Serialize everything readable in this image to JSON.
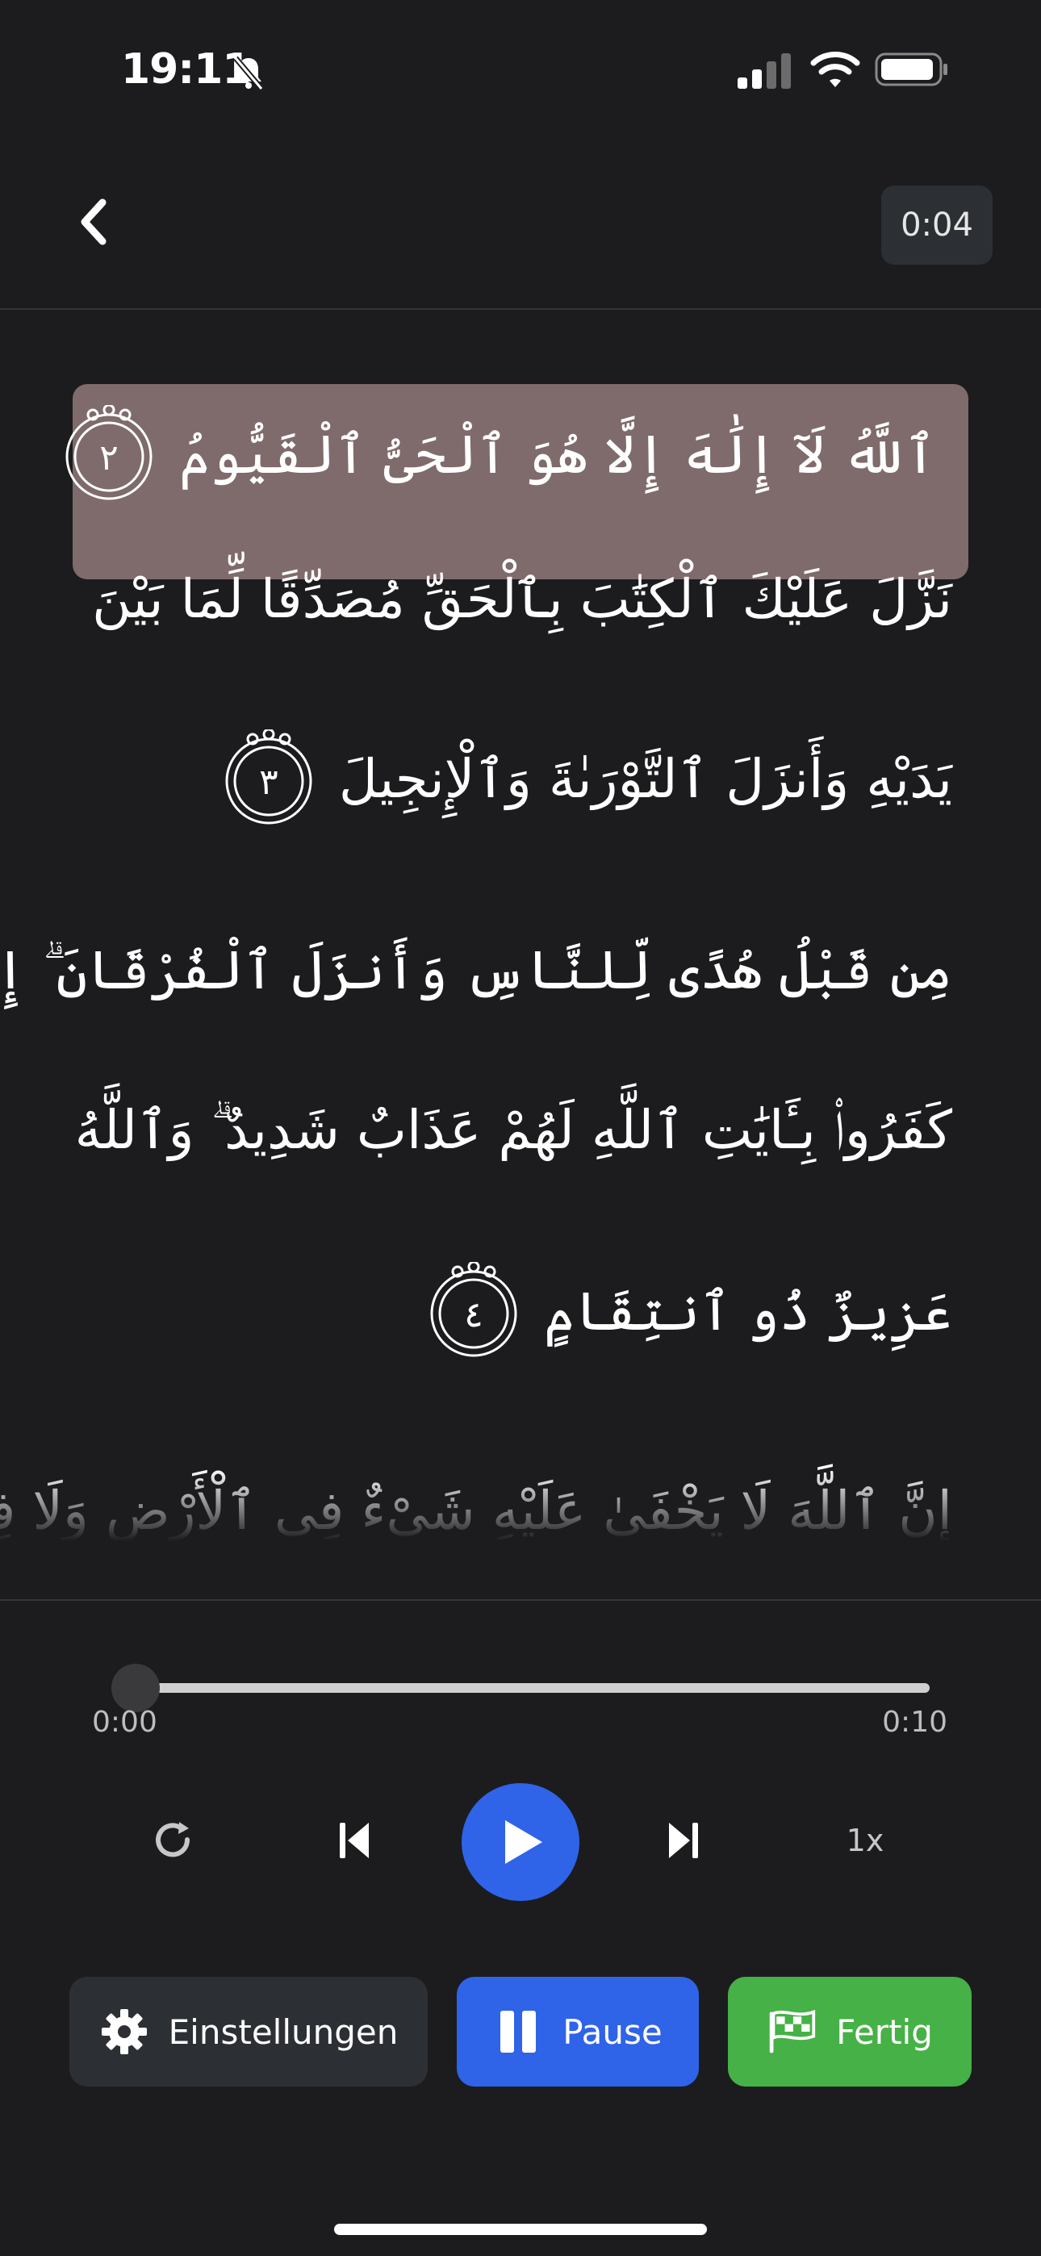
{
  "status_bar": {
    "time": "19:11",
    "icons": [
      "bell-off-icon",
      "signal-icon",
      "wifi-icon",
      "battery-icon"
    ]
  },
  "header": {
    "back_icon": "chevron-left-icon",
    "elapsed_badge": "0:04"
  },
  "verses": {
    "highlight_color": "#7f6b6b",
    "lines": [
      {
        "text": "ٱللَّهُ لَآ إِلَٰهَ إِلَّا هُوَ ٱلْحَىُّ ٱلْقَيُّومُ",
        "ayah": "٢"
      },
      {
        "text": "نَزَّلَ عَلَيْكَ ٱلْكِتَٰبَ بِٱلْحَقِّ مُصَدِّقًا لِّمَا بَيْنَ",
        "ayah": ""
      },
      {
        "text": "يَدَيْهِ وَأَنزَلَ ٱلتَّوْرَىٰةَ وَٱلْإِنجِيلَ",
        "ayah": "٣"
      },
      {
        "text": "مِن قَبْلُ هُدًى لِّلنَّاسِ وَأَنزَلَ ٱلْفُرْقَانَ ۗ إِنَّ ٱلَّذِينَ",
        "ayah": ""
      },
      {
        "text": "كَفَرُوا۟ بِـَٔايَٰتِ ٱللَّهِ لَهُمْ عَذَابٌ شَدِيدٌ ۗ وَٱللَّهُ",
        "ayah": ""
      },
      {
        "text": "عَزِيزٌ ذُو ٱنتِقَامٍ",
        "ayah": "٤"
      },
      {
        "text": "إِنَّ ٱللَّهَ لَا يَخْفَىٰ عَلَيْهِ شَىْءٌ فِى ٱلْأَرْضِ وَلَا فِى",
        "ayah": ""
      }
    ]
  },
  "player": {
    "progress": 0.0,
    "time_start": "0:00",
    "time_end": "0:10",
    "repeat_icon": "repeat-icon",
    "prev_icon": "skip-previous-icon",
    "play_icon": "play-icon",
    "next_icon": "skip-next-icon",
    "speed_label": "1x",
    "accent_color": "#2f63e8"
  },
  "actions": {
    "settings_label": "Einstellungen",
    "settings_icon": "gear-icon",
    "pause_label": "Pause",
    "pause_icon": "pause-icon",
    "done_label": "Fertig",
    "done_icon": "checkered-flag-icon",
    "done_color": "#46b146"
  }
}
